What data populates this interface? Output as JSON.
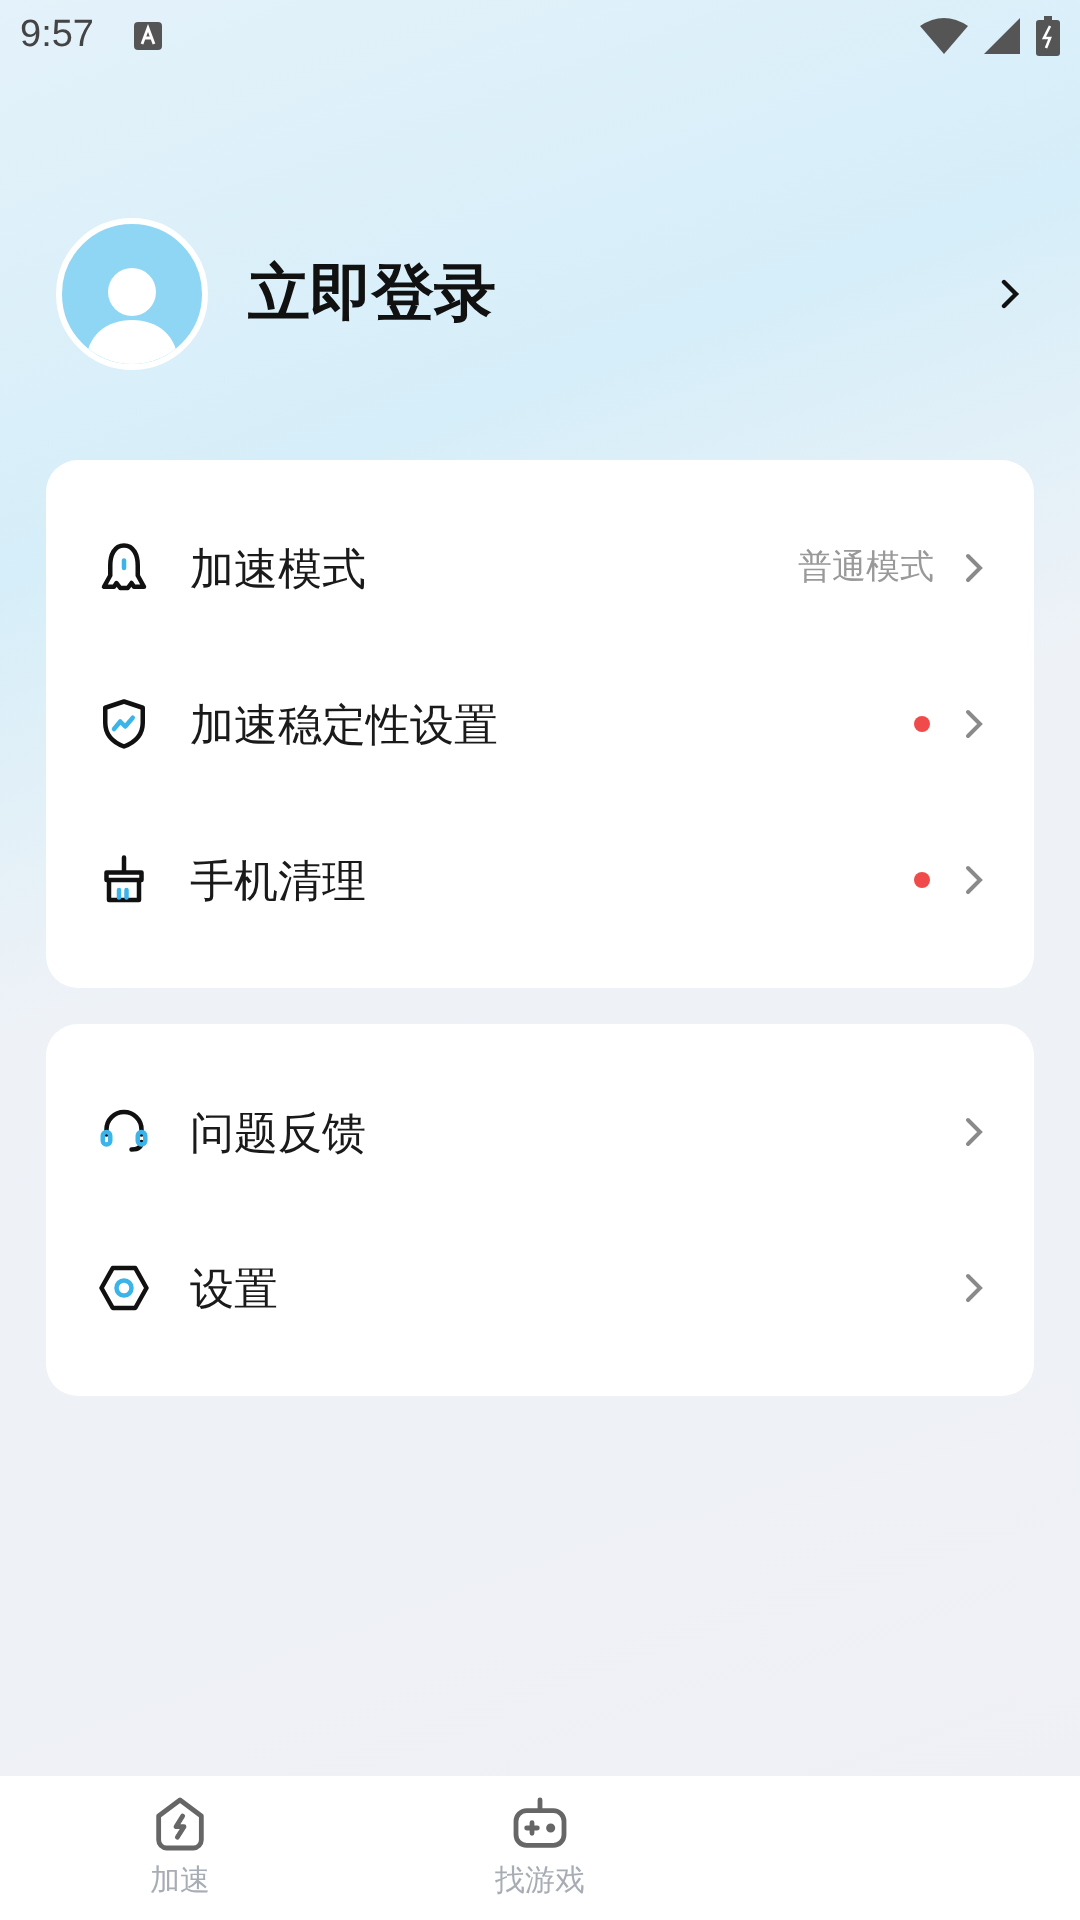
{
  "status_bar": {
    "time": "9:57"
  },
  "profile": {
    "name": "立即登录"
  },
  "groups": [
    {
      "items": [
        {
          "kind": "ghost",
          "label": "加速模式",
          "value": "普通模式",
          "dot": false
        },
        {
          "kind": "shield",
          "label": "加速稳定性设置",
          "dot": true
        },
        {
          "kind": "broom",
          "label": "手机清理",
          "dot": true
        }
      ]
    },
    {
      "items": [
        {
          "kind": "headset",
          "label": "问题反馈",
          "dot": false
        },
        {
          "kind": "hexagon",
          "label": "设置",
          "dot": false
        }
      ]
    }
  ],
  "tabs": [
    {
      "kind": "bolt",
      "label": "加速",
      "selected": false
    },
    {
      "kind": "gamepad",
      "label": "找游戏",
      "selected": false
    }
  ]
}
